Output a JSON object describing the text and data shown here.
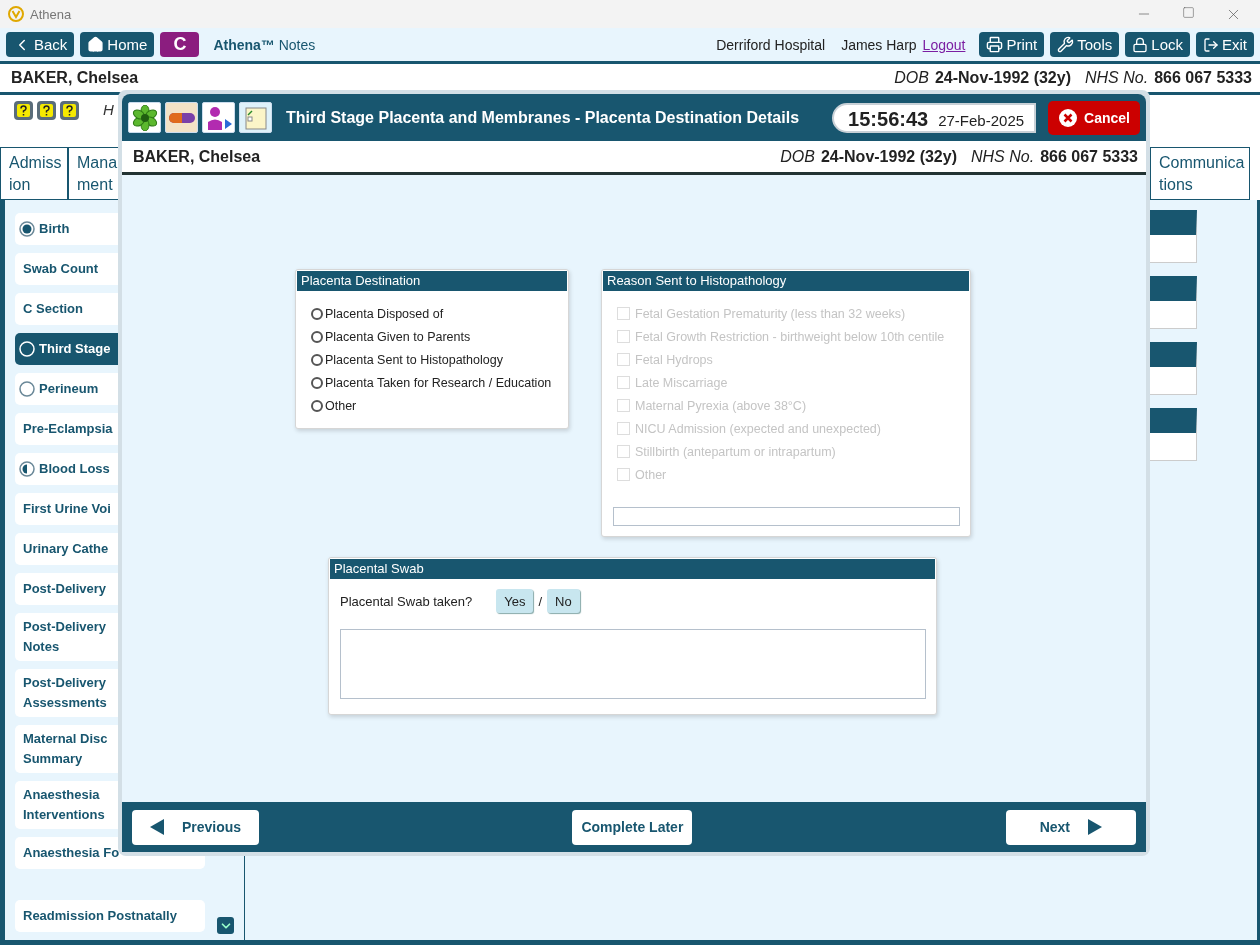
{
  "window": {
    "title": "Athena"
  },
  "toolbar": {
    "left_buttons": [
      {
        "kind": "back",
        "label": "Back"
      },
      {
        "kind": "home",
        "label": "Home"
      },
      {
        "kind": "letter",
        "label": "C"
      }
    ],
    "app_name": "Athena™",
    "app_suffix": "Notes",
    "hospital": "Derriford Hospital",
    "user": "James Harp",
    "logout": "Logout",
    "right_buttons": [
      {
        "kind": "print",
        "label": "Print"
      },
      {
        "kind": "tools",
        "label": "Tools"
      },
      {
        "kind": "lock",
        "label": "Lock"
      },
      {
        "kind": "exit",
        "label": "Exit"
      }
    ]
  },
  "patient": {
    "name": "BAKER, Chelsea",
    "dob_label": "DOB",
    "dob": "24-Nov-1992 (32y)",
    "nhs_label": "NHS No.",
    "nhs": "866 067 5333"
  },
  "heading_fragment": "H",
  "tabs": [
    {
      "lines": [
        "Admiss",
        "ion"
      ],
      "selected": false
    },
    {
      "lines": [
        "Mana",
        "ment"
      ],
      "selected": false
    },
    {
      "lines": [
        "Communica",
        "tions"
      ],
      "selected": false
    }
  ],
  "sidebar": {
    "items": [
      {
        "lines": [
          "Birth"
        ],
        "kind": "complete",
        "selected": false
      },
      {
        "lines": [
          "Swab Count"
        ],
        "kind": "plain",
        "selected": false
      },
      {
        "lines": [
          "C Section"
        ],
        "kind": "plain",
        "selected": false
      },
      {
        "lines": [
          "Third Stage"
        ],
        "kind": "open",
        "selected": true
      },
      {
        "lines": [
          "Perineum"
        ],
        "kind": "open",
        "selected": false
      },
      {
        "lines": [
          "Pre-Eclampsia"
        ],
        "kind": "plain",
        "selected": false
      },
      {
        "lines": [
          "Blood Loss"
        ],
        "kind": "partial",
        "selected": false
      },
      {
        "lines": [
          "First Urine Voi"
        ],
        "kind": "plain",
        "selected": false
      },
      {
        "lines": [
          "Urinary Cathe"
        ],
        "kind": "plain",
        "selected": false
      },
      {
        "lines": [
          "Post-Delivery"
        ],
        "kind": "plain",
        "selected": false
      },
      {
        "lines": [
          "Post-Delivery",
          "Notes"
        ],
        "kind": "plain",
        "selected": false
      },
      {
        "lines": [
          "Post-Delivery",
          "Assessments"
        ],
        "kind": "plain",
        "selected": false
      },
      {
        "lines": [
          "Maternal Disc",
          "Summary"
        ],
        "kind": "plain",
        "selected": false
      },
      {
        "lines": [
          "Anaesthesia",
          "Interventions"
        ],
        "kind": "plain",
        "selected": false
      },
      {
        "lines": [
          "Anaesthesia Fo"
        ],
        "kind": "plain",
        "selected": false
      }
    ],
    "bottom_item": {
      "lines": [
        "Readmission Postnatally"
      ],
      "kind": "plain",
      "selected": false
    }
  },
  "dialog": {
    "title": "Third Stage Placenta and Membranes - Placenta Destination Details",
    "time": "15:56:43",
    "date": "27-Feb-2025",
    "cancel": "Cancel",
    "patient": {
      "name": "BAKER, Chelsea",
      "dob_label": "DOB",
      "dob": "24-Nov-1992 (32y)",
      "nhs_label": "NHS No.",
      "nhs": "866 067 5333"
    },
    "destination": {
      "title": "Placenta Destination",
      "options": [
        {
          "label": "Placenta Disposed of",
          "selected": false
        },
        {
          "label": "Placenta Given to Parents",
          "selected": false
        },
        {
          "label": "Placenta Sent to Histopathology",
          "selected": false
        },
        {
          "label": "Placenta Taken for Research / Education",
          "selected": false
        },
        {
          "label": "Other",
          "selected": false
        }
      ]
    },
    "reason": {
      "title": "Reason Sent to Histopathology",
      "options": [
        {
          "label": "Fetal Gestation Prematurity (less than 32 weeks)",
          "checked": false,
          "disabled": true
        },
        {
          "label": "Fetal Growth Restriction - birthweight below 10th centile",
          "checked": false,
          "disabled": true
        },
        {
          "label": "Fetal Hydrops",
          "checked": false,
          "disabled": true
        },
        {
          "label": "Late Miscarriage",
          "checked": false,
          "disabled": true
        },
        {
          "label": "Maternal Pyrexia (above 38°C)",
          "checked": false,
          "disabled": true
        },
        {
          "label": "NICU Admission (expected and unexpected)",
          "checked": false,
          "disabled": true
        },
        {
          "label": "Stillbirth (antepartum or intrapartum)",
          "checked": false,
          "disabled": true
        },
        {
          "label": "Other",
          "checked": false,
          "disabled": true
        }
      ]
    },
    "swab": {
      "title": "Placental Swab",
      "question": "Placental Swab taken?",
      "separator": "/",
      "answers": [
        {
          "label": "Yes",
          "selected": false
        },
        {
          "label": "No",
          "selected": false
        }
      ]
    },
    "footer": {
      "previous": "Previous",
      "later": "Complete Later",
      "next": "Next"
    }
  }
}
